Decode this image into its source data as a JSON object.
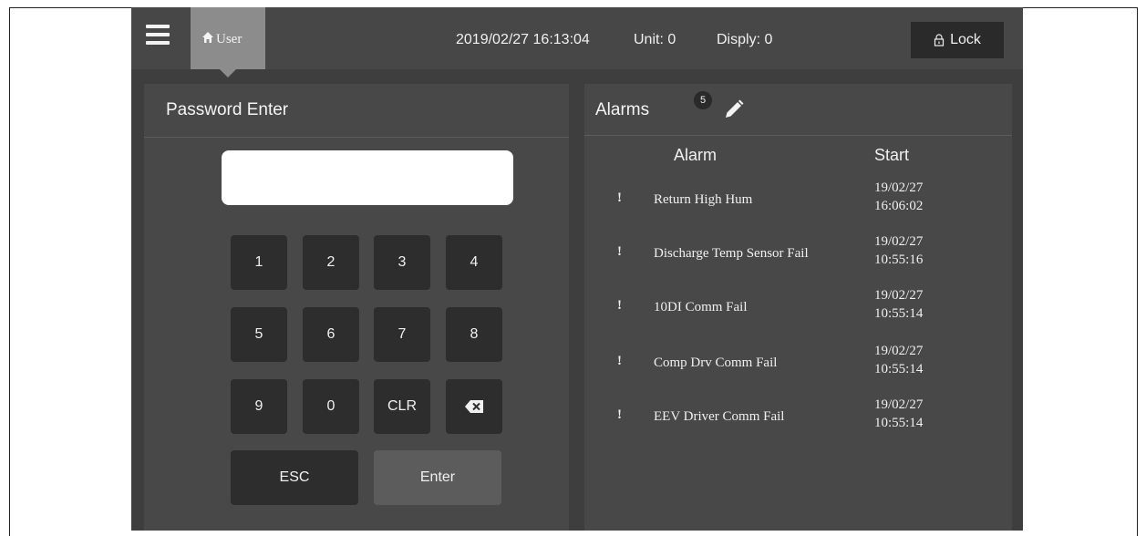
{
  "header": {
    "user_label": "User",
    "datetime": "2019/02/27 16:13:04",
    "unit_label": "Unit: 0",
    "display_label": "Disply: 0",
    "lock_label": "Lock"
  },
  "password_panel": {
    "title": "Password Enter",
    "input_value": "",
    "keys": {
      "k1": "1",
      "k2": "2",
      "k3": "3",
      "k4": "4",
      "k5": "5",
      "k6": "6",
      "k7": "7",
      "k8": "8",
      "k9": "9",
      "k0": "0",
      "clr": "CLR",
      "esc": "ESC",
      "enter": "Enter"
    }
  },
  "alarms_panel": {
    "title": "Alarms",
    "count": "5",
    "col_alarm": "Alarm",
    "col_start": "Start",
    "items": [
      {
        "mark": "!",
        "name": "Return High Hum",
        "date": "19/02/27",
        "time": "16:06:02"
      },
      {
        "mark": "!",
        "name": "Discharge Temp Sensor Fail",
        "date": "19/02/27",
        "time": "10:55:16"
      },
      {
        "mark": "!",
        "name": "10DI Comm Fail",
        "date": "19/02/27",
        "time": "10:55:14"
      },
      {
        "mark": "!",
        "name": "Comp Drv Comm Fail",
        "date": "19/02/27",
        "time": "10:55:14"
      },
      {
        "mark": "!",
        "name": "EEV Driver Comm Fail",
        "date": "19/02/27",
        "time": "10:55:14"
      }
    ]
  },
  "colors": {
    "background": "#3e3e3e",
    "header": "#474747",
    "panel": "#484848",
    "key": "#2d2d2d",
    "user_tab": "#8c8c8c"
  },
  "icons": [
    "menu-icon",
    "home-icon",
    "lock-icon",
    "backspace-icon",
    "edit-pencil-icon"
  ]
}
